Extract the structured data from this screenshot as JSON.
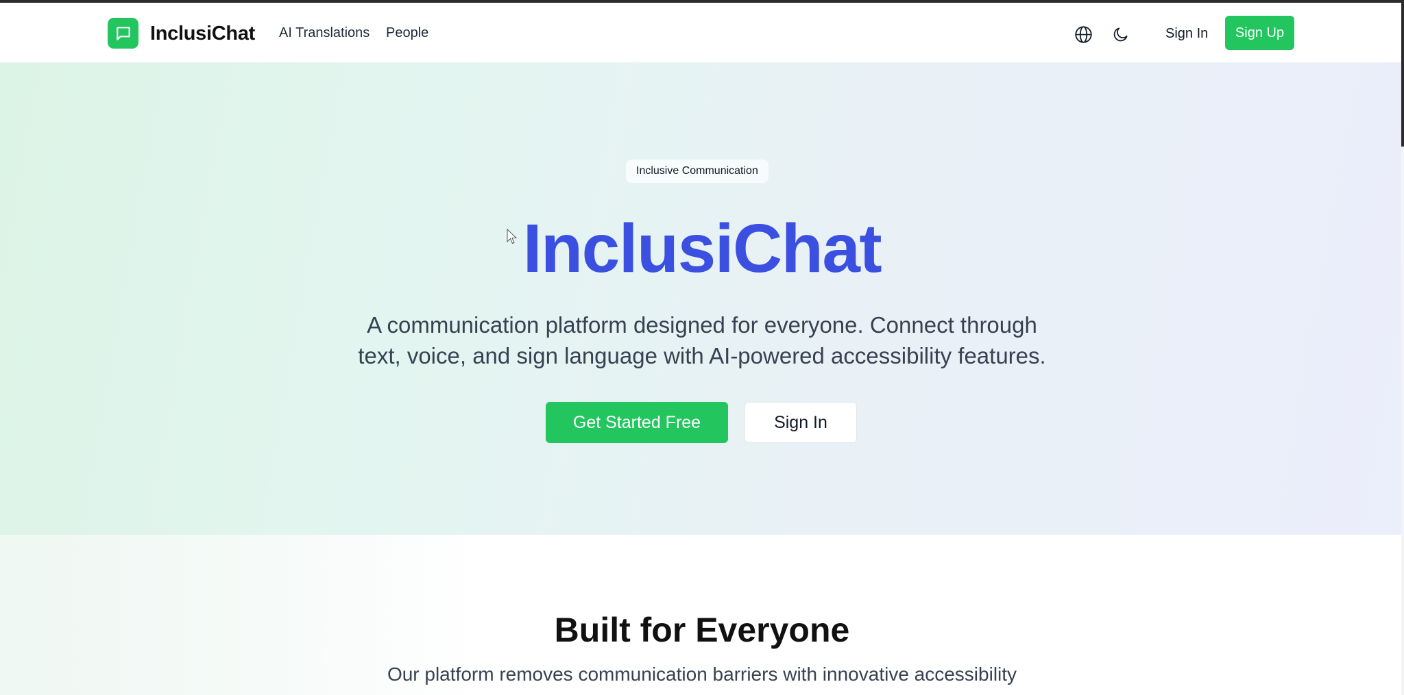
{
  "header": {
    "brand": "InclusiChat",
    "nav": [
      {
        "label": "AI Translations"
      },
      {
        "label": "People"
      }
    ],
    "icons": [
      "globe-icon",
      "moon-icon",
      "chat-bubble-icon"
    ],
    "sign_in": "Sign In",
    "sign_up": "Sign Up"
  },
  "hero": {
    "badge": "Inclusive Communication",
    "title": "InclusiChat",
    "subtitle_line1": "A communication platform designed for everyone. Connect through",
    "subtitle_line2": "text, voice, and sign language with AI-powered accessibility features.",
    "cta_primary": "Get Started Free",
    "cta_secondary": "Sign In"
  },
  "features": {
    "title": "Built for Everyone",
    "subtitle": "Our platform removes communication barriers with innovative accessibility"
  },
  "colors": {
    "accent_green": "#22c55e",
    "title_blue": "#3b4fe0"
  }
}
